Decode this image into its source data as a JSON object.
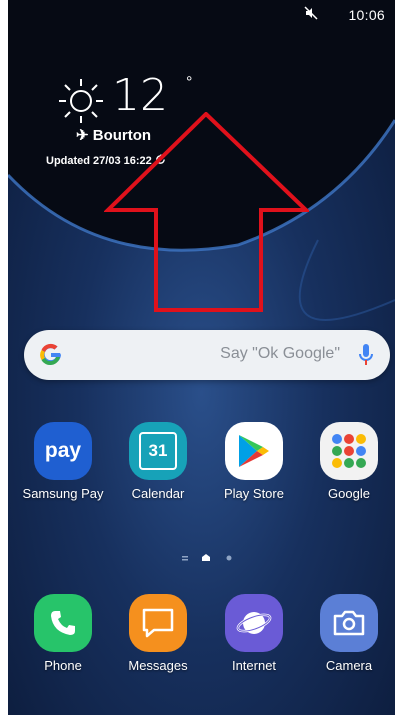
{
  "status": {
    "time": "10:06",
    "mute_icon": "mute-icon"
  },
  "weather": {
    "temperature": "12",
    "degree": "°",
    "location": "Bourton",
    "updated": "Updated 27/03 16:22"
  },
  "search": {
    "placeholder": "Say \"Ok Google\""
  },
  "apps_row1": [
    {
      "label": "Samsung Pay",
      "icon": "pay-icon",
      "icon_text": "pay"
    },
    {
      "label": "Calendar",
      "icon": "calendar-icon",
      "icon_text": "31"
    },
    {
      "label": "Play Store",
      "icon": "play-store-icon"
    },
    {
      "label": "Google",
      "icon": "google-folder-icon"
    }
  ],
  "dock": [
    {
      "label": "Phone",
      "icon": "phone-icon"
    },
    {
      "label": "Messages",
      "icon": "messages-icon"
    },
    {
      "label": "Internet",
      "icon": "internet-icon"
    },
    {
      "label": "Camera",
      "icon": "camera-icon"
    }
  ],
  "colors": {
    "pay": "#1f5fd1",
    "calendar": "#17a2b8",
    "phone": "#27c46a",
    "messages": "#f5901e",
    "internet": "#6a5bd6",
    "camera": "#5b7fd6",
    "arrow": "#e0111b"
  }
}
